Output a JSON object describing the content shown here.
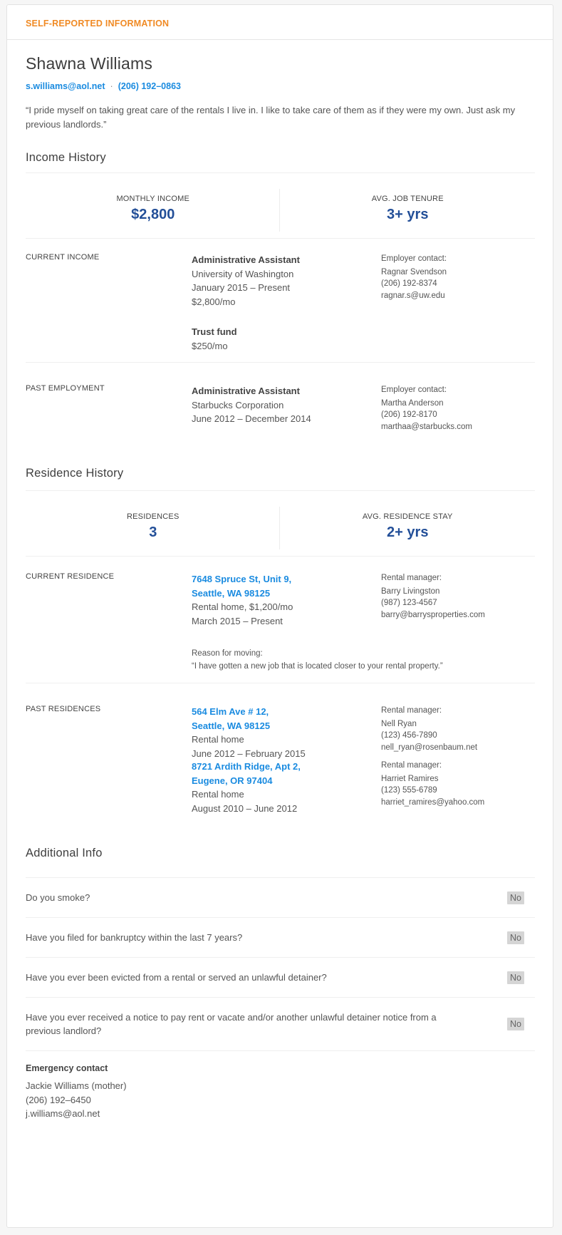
{
  "header": {
    "label": "SELF-REPORTED INFORMATION",
    "accent_color": "#f08a24"
  },
  "applicant": {
    "name": "Shawna Williams",
    "email": "s.williams@aol.net",
    "separator": "·",
    "phone": "(206) 192–0863",
    "quote": "“I pride myself on taking great care of the rentals I live in. I like to take care of them as if they were my own. Just ask my previous landlords.”"
  },
  "income_history": {
    "title": "Income History",
    "stats": [
      {
        "label": "MONTHLY INCOME",
        "value": "$2,800"
      },
      {
        "label": "AVG. JOB TENURE",
        "value": "3+ yrs"
      }
    ],
    "current_income": {
      "label": "CURRENT INCOME",
      "job": {
        "title": "Administrative Assistant",
        "employer": "University of Washington",
        "dates": "January 2015 – Present",
        "pay": "$2,800/mo"
      },
      "contact": {
        "header": "Employer contact:",
        "name": "Ragnar Svendson",
        "phone": "(206) 192-8374",
        "email": "ragnar.s@uw.edu"
      },
      "other": {
        "title": "Trust fund",
        "pay": "$250/mo"
      }
    },
    "past_employment": {
      "label": "PAST EMPLOYMENT",
      "job": {
        "title": "Administrative Assistant",
        "employer": "Starbucks Corporation",
        "dates": "June 2012 – December 2014"
      },
      "contact": {
        "header": "Employer contact:",
        "name": "Martha Anderson",
        "phone": "(206) 192-8170",
        "email": "marthaa@starbucks.com"
      }
    }
  },
  "residence_history": {
    "title": "Residence History",
    "stats": [
      {
        "label": "RESIDENCES",
        "value": "3"
      },
      {
        "label": "AVG. RESIDENCE STAY",
        "value": "2+ yrs"
      }
    ],
    "current_residence": {
      "label": "CURRENT RESIDENCE",
      "address_line1": "7648 Spruce St, Unit 9,",
      "address_line2": "Seattle, WA 98125",
      "type": "Rental home, $1,200/mo",
      "dates": "March 2015 – Present",
      "manager": {
        "header": "Rental manager:",
        "name": "Barry Livingston",
        "phone": "(987) 123-4567",
        "email": "barry@barrysproperties.com"
      },
      "reason_label": "Reason for moving:",
      "reason": "“I have gotten a new job that is located closer to your rental property.”"
    },
    "past_residences": {
      "label": "PAST RESIDENCES",
      "items": [
        {
          "address_line1": "564 Elm Ave # 12,",
          "address_line2": "Seattle, WA 98125",
          "type": "Rental home",
          "dates": "June 2012 – February 2015",
          "manager": {
            "header": "Rental manager:",
            "name": "Nell Ryan",
            "phone": "(123) 456-7890",
            "email": "nell_ryan@rosenbaum.net"
          }
        },
        {
          "address_line1": "8721 Ardith Ridge, Apt 2,",
          "address_line2": "Eugene, OR 97404",
          "type": "Rental home",
          "dates": "August 2010 – June 2012",
          "manager": {
            "header": "Rental manager:",
            "name": "Harriet Ramires",
            "phone": "(123) 555-6789",
            "email": "harriet_ramires@yahoo.com"
          }
        }
      ]
    }
  },
  "additional_info": {
    "title": "Additional Info",
    "questions": [
      {
        "question": "Do you smoke?",
        "answer": "No"
      },
      {
        "question": "Have you filed for bankruptcy within the last 7 years?",
        "answer": "No"
      },
      {
        "question": "Have you ever been evicted from a rental or served an unlawful detainer?",
        "answer": "No"
      },
      {
        "question": "Have you ever received a notice to pay rent or vacate and/or another unlawful detainer notice from a previous landlord?",
        "answer": "No"
      }
    ],
    "emergency_contact": {
      "title": "Emergency contact",
      "name": "Jackie Williams (mother)",
      "phone": "(206) 192–6450",
      "email": "j.williams@aol.net"
    }
  }
}
